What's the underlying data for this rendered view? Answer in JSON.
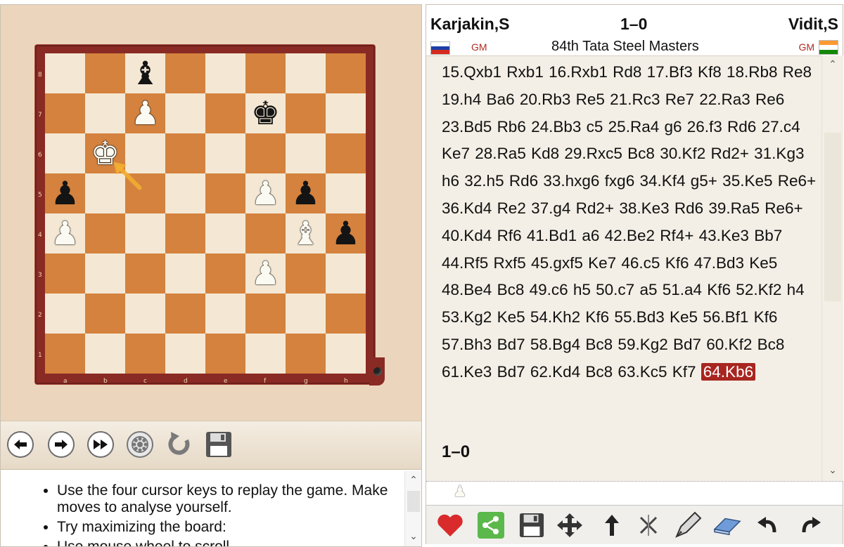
{
  "board": {
    "ranks": [
      "8",
      "7",
      "6",
      "5",
      "4",
      "3",
      "2",
      "1"
    ],
    "files": [
      "a",
      "b",
      "c",
      "d",
      "e",
      "f",
      "g",
      "h"
    ],
    "pieces": [
      {
        "square": "c8",
        "glyph": "♝",
        "color": "black",
        "name": "black-bishop-c8"
      },
      {
        "square": "c7",
        "glyph": "♟",
        "color": "white",
        "name": "white-pawn-c7"
      },
      {
        "square": "f7",
        "glyph": "♚",
        "color": "black",
        "name": "black-king-f7"
      },
      {
        "square": "b6",
        "glyph": "♚",
        "color": "white",
        "name": "white-king-b6"
      },
      {
        "square": "a5",
        "glyph": "♟",
        "color": "black",
        "name": "black-pawn-a5"
      },
      {
        "square": "f5",
        "glyph": "♟",
        "color": "white",
        "name": "white-pawn-f5"
      },
      {
        "square": "g5",
        "glyph": "♟",
        "color": "black",
        "name": "black-pawn-g5"
      },
      {
        "square": "a4",
        "glyph": "♟",
        "color": "white",
        "name": "white-pawn-a4"
      },
      {
        "square": "g4",
        "glyph": "♝",
        "color": "white",
        "name": "white-bishop-g4"
      },
      {
        "square": "h4",
        "glyph": "♟",
        "color": "black",
        "name": "black-pawn-h4"
      },
      {
        "square": "f3",
        "glyph": "♟",
        "color": "white",
        "name": "white-pawn-f3"
      }
    ],
    "last_move": {
      "from": "c5",
      "to": "b6"
    },
    "arrow_color": "#f4b030"
  },
  "controls": [
    {
      "name": "back-button",
      "icon": "arrow-left-icon",
      "glyph": "🡐"
    },
    {
      "name": "forward-button",
      "icon": "arrow-right-icon",
      "glyph": "🡒"
    },
    {
      "name": "fast-forward-button",
      "icon": "fast-forward-icon",
      "glyph": "⏩"
    },
    {
      "name": "engine-button",
      "icon": "gear-wheel-icon",
      "glyph": "⚙"
    },
    {
      "name": "flip-board-button",
      "icon": "rotate-icon",
      "glyph": "↺"
    },
    {
      "name": "save-button",
      "icon": "floppy-disk-icon",
      "glyph": "💾"
    }
  ],
  "help": {
    "items": [
      "Use the four cursor keys to replay the game. Make moves to analyse yourself.",
      "Try maximizing the board:",
      "Use mouse wheel to scroll."
    ]
  },
  "game": {
    "white": "Karjakin,S",
    "black": "Vidit,S",
    "result": "1–0",
    "white_title": "GM",
    "black_title": "GM",
    "event": "84th Tata Steel Masters",
    "white_flag_colors": [
      "#ffffff",
      "#1c3fa8",
      "#d52b1e"
    ],
    "black_flag_colors": [
      "#ff9933",
      "#ffffff",
      "#138808"
    ],
    "moves_text": "15.Qxb1 Rxb1 16.Rxb1 Rd8 17.Bf3 Kf8 18.Rb8 Re8 19.h4 Ba6 20.Rb3 Re5 21.Rc3 Re7 22.Ra3 Re6 23.Bd5 Rb6 24.Bb3 c5 25.Ra4 g6 26.f3 Rd6 27.c4 Ke7 28.Ra5 Kd8 29.Rxc5 Bc8 30.Kf2 Rd2+ 31.Kg3 h6 32.h5 Rd6 33.hxg6 fxg6 34.Kf4 g5+ 35.Ke5 Re6+ 36.Kd4 Re2 37.g4 Rd2+ 38.Ke3 Rd6 39.Ra5 Re6+ 40.Kd4 Rf6 41.Bd1 a6 42.Be2 Rf4+ 43.Ke3 Bb7 44.Rf5 Rxf5 45.gxf5 Ke7 46.c5 Kf6 47.Bd3 Ke5 48.Be4 Bc8 49.c6 h5 50.c7 a5 51.a4 Kf6 52.Kf2 h4 53.Kg2 Ke5 54.Kh2 Kf6 55.Bd3 Ke5 56.Bf1 Kf6 57.Bh3 Bd7 58.Bg4 Bc8 59.Kg2 Bd7 60.Kf2 Bc8 61.Ke3 Bd7 62.Kd4 Bc8 63.Kc5 Kf7",
    "current_move": "64.Kb6",
    "final_result": "1–0"
  },
  "toolbar": [
    {
      "name": "like-button",
      "icon": "heart-icon"
    },
    {
      "name": "share-button",
      "icon": "share-icon"
    },
    {
      "name": "save-game-button",
      "icon": "floppy-disk-icon"
    },
    {
      "name": "move-entry-button",
      "icon": "move-arrows-icon"
    },
    {
      "name": "promote-variation-button",
      "icon": "arrow-up-icon"
    },
    {
      "name": "delete-variation-button",
      "icon": "delete-icon"
    },
    {
      "name": "annotate-button",
      "icon": "pen-icon"
    },
    {
      "name": "erase-button",
      "icon": "eraser-icon"
    },
    {
      "name": "undo-button",
      "icon": "undo-icon"
    },
    {
      "name": "redo-button",
      "icon": "redo-icon"
    }
  ],
  "accent": "#a82620"
}
